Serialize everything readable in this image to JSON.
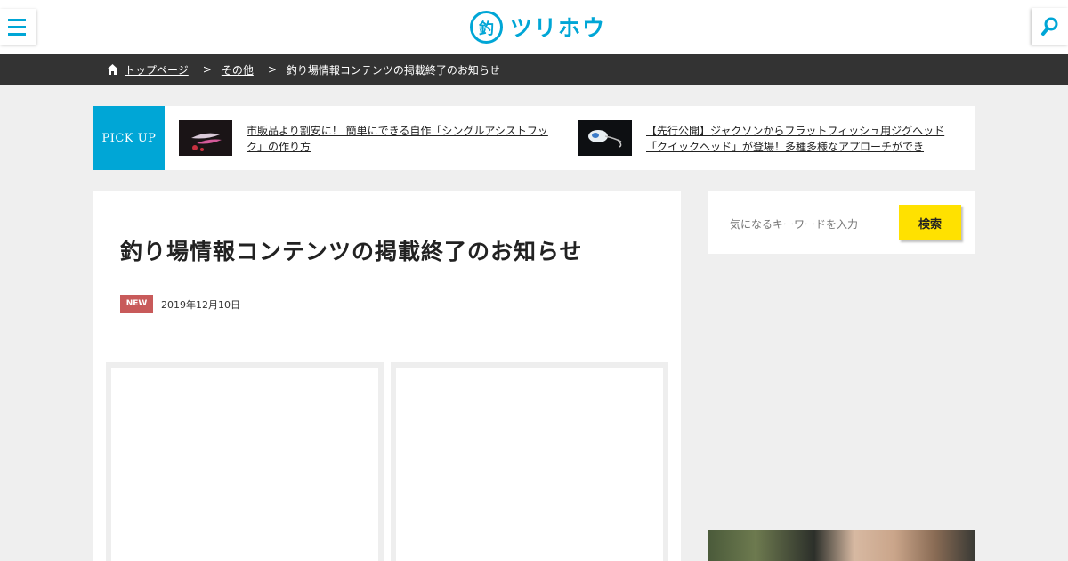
{
  "header": {
    "logo_mark": "釣",
    "logo_text": "ツリホウ",
    "accent_color": "#00a6d6",
    "menu_icon": "hamburger-icon",
    "search_icon": "search-icon"
  },
  "breadcrumb": {
    "home_icon": "home-icon",
    "items": [
      "トップページ",
      "その他"
    ],
    "separator": ">",
    "current": "釣り場情報コンテンツの掲載終了のお知らせ"
  },
  "pickup": {
    "label": "PICK UP",
    "items": [
      {
        "title": "市販品より割安に！ 簡単にできる自作「シングルアシストフック」の作り方"
      },
      {
        "title": "【先行公開】ジャクソンからフラットフィッシュ用ジグヘッド「クイックヘッド」が登場！多種多様なアプローチができ"
      }
    ]
  },
  "article": {
    "title": "釣り場情報コンテンツの掲載終了のお知らせ",
    "badge": "NEW",
    "badge_color": "#c85a5a",
    "date": "2019年12月10日"
  },
  "sidebar": {
    "search_placeholder": "気になるキーワードを入力",
    "search_button": "検索",
    "button_color": "#ffe100"
  }
}
